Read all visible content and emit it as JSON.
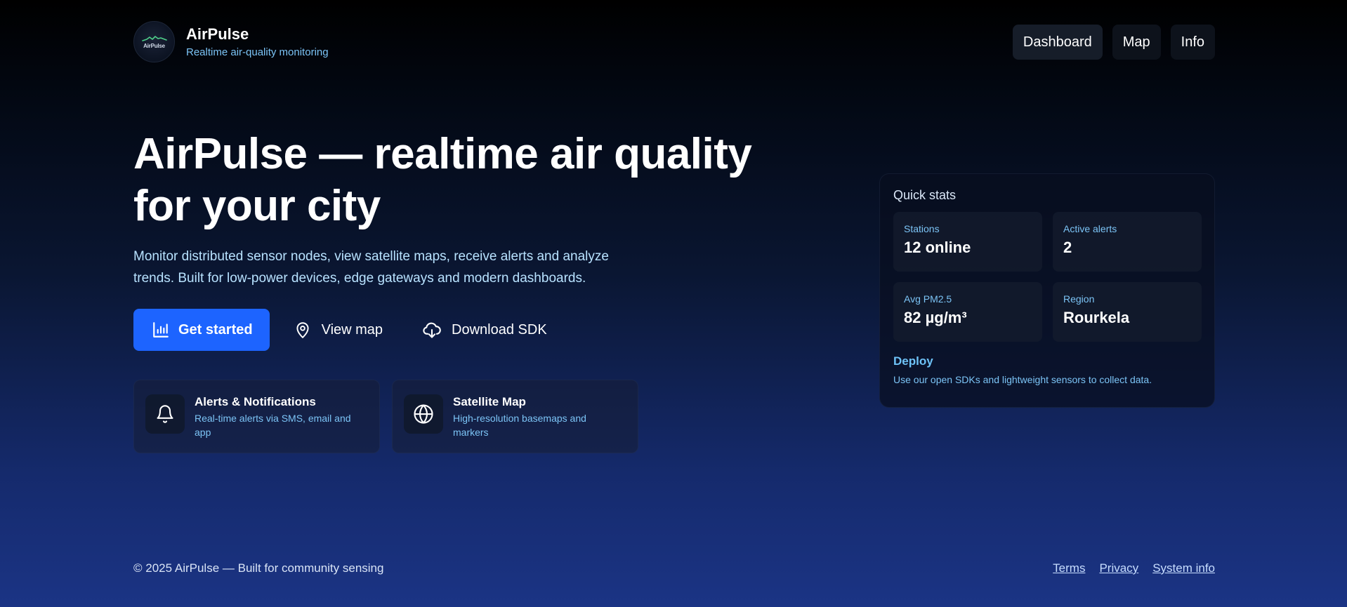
{
  "header": {
    "logo_text": "AirPulse",
    "brand_name": "AirPulse",
    "brand_tagline": "Realtime air-quality monitoring",
    "nav": [
      {
        "label": "Dashboard",
        "active": true
      },
      {
        "label": "Map",
        "active": false
      },
      {
        "label": "Info",
        "active": false
      }
    ]
  },
  "hero": {
    "title": "AirPulse — realtime air quality for your city",
    "description": "Monitor distributed sensor nodes, view satellite maps, receive alerts and analyze trends. Built for low-power devices, edge gateways and modern dashboards.",
    "actions": {
      "primary": {
        "label": "Get started",
        "icon": "bar-chart-icon"
      },
      "view_map": {
        "label": "View map",
        "icon": "map-pin-icon"
      },
      "download_sdk": {
        "label": "Download SDK",
        "icon": "cloud-download-icon"
      }
    },
    "features": [
      {
        "title": "Alerts & Notifications",
        "desc": "Real-time alerts via SMS, email and app",
        "icon": "bell-icon"
      },
      {
        "title": "Satellite Map",
        "desc": "High-resolution basemaps and markers",
        "icon": "globe-icon"
      }
    ]
  },
  "quick_stats": {
    "title": "Quick stats",
    "stats": [
      {
        "label": "Stations",
        "value": "12 online"
      },
      {
        "label": "Active alerts",
        "value": "2"
      },
      {
        "label": "Avg PM2.5",
        "value": "82 µg/m³"
      },
      {
        "label": "Region",
        "value": "Rourkela"
      }
    ],
    "deploy_title": "Deploy",
    "deploy_desc": "Use our open SDKs and lightweight sensors to collect data."
  },
  "footer": {
    "copyright": "© 2025 AirPulse — Built for community sensing",
    "links": [
      "Terms",
      "Privacy",
      "System info"
    ]
  },
  "colors": {
    "accent": "#1d64ff",
    "link_blue": "#7cc4f6",
    "background_top": "#000000",
    "background_bottom": "#1b3485"
  }
}
